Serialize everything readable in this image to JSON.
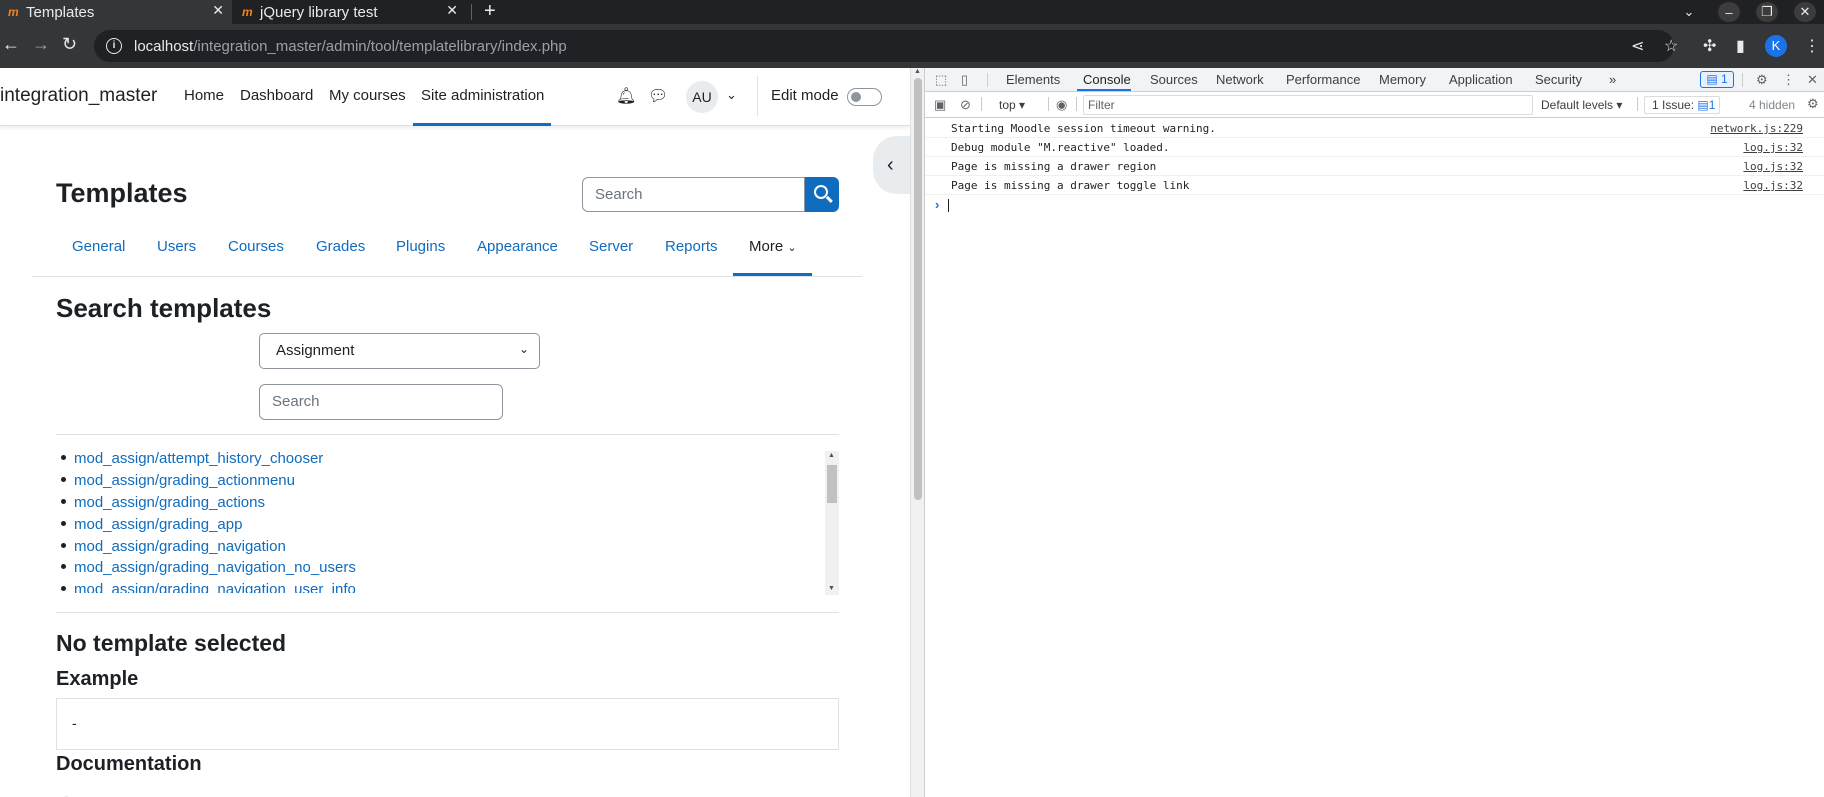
{
  "browser": {
    "tabs": [
      {
        "label": "Templates",
        "active": true
      },
      {
        "label": "jQuery library test",
        "active": false
      }
    ],
    "new_tab_label": "+",
    "url_host": "localhost",
    "url_path": "/integration_master/admin/tool/templatelibrary/index.php",
    "profile_initial": "K"
  },
  "moodle": {
    "brand": "integration_master",
    "nav": [
      {
        "label": "Home"
      },
      {
        "label": "Dashboard"
      },
      {
        "label": "My courses"
      },
      {
        "label": "Site administration",
        "active": true
      }
    ],
    "avatar_initials": "AU",
    "edit_mode_label": "Edit mode",
    "edit_mode_on": false,
    "page_title": "Templates",
    "top_search_placeholder": "Search",
    "secondary_nav": [
      {
        "label": "General"
      },
      {
        "label": "Users"
      },
      {
        "label": "Courses"
      },
      {
        "label": "Grades"
      },
      {
        "label": "Plugins"
      },
      {
        "label": "Appearance"
      },
      {
        "label": "Server"
      },
      {
        "label": "Reports"
      },
      {
        "label": "More",
        "active": true
      }
    ],
    "search_heading": "Search templates",
    "component_select_value": "Assignment",
    "template_search_placeholder": "Search",
    "templates": [
      "mod_assign/attempt_history_chooser",
      "mod_assign/grading_actionmenu",
      "mod_assign/grading_actions",
      "mod_assign/grading_app",
      "mod_assign/grading_navigation",
      "mod_assign/grading_navigation_no_users",
      "mod_assign/grading_navigation_user_info"
    ],
    "no_template_heading": "No template selected",
    "example_heading": "Example",
    "example_value": "-",
    "documentation_heading": "Documentation",
    "documentation_value": "-"
  },
  "devtools": {
    "tabs": [
      "Elements",
      "Console",
      "Sources",
      "Network",
      "Performance",
      "Memory",
      "Application",
      "Security"
    ],
    "active_tab": "Console",
    "more_tabs": "»",
    "message_badge": "1",
    "context": "top",
    "filter_placeholder": "Filter",
    "levels": "Default levels",
    "issue_label": "1 Issue:",
    "issue_count": "1",
    "hidden_label": "4 hidden",
    "messages": [
      {
        "text": "Starting Moodle session timeout warning.",
        "source": "network.js:229"
      },
      {
        "text": "Debug module \"M.reactive\" loaded.",
        "source": "log.js:32"
      },
      {
        "text": "Page is missing a drawer region",
        "source": "log.js:32"
      },
      {
        "text": "Page is missing a drawer toggle link",
        "source": "log.js:32"
      }
    ]
  }
}
